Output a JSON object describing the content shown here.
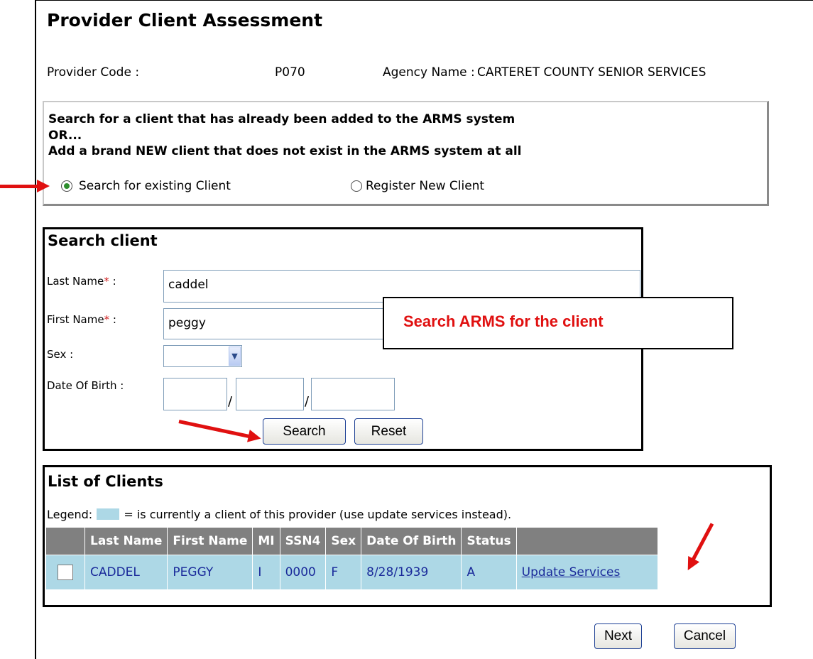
{
  "header": {
    "title": "Provider Client Assessment"
  },
  "provider": {
    "code_label": "Provider Code :",
    "code_value": "P070",
    "agency_label": "Agency Name :",
    "agency_value": "CARTERET COUNTY SENIOR SERVICES"
  },
  "search_mode": {
    "line1": "Search for a client that has already been added to the ARMS system",
    "line2": "OR...",
    "line3": "Add a brand NEW client that does not exist in the ARMS system at all",
    "option_existing": "Search for existing Client",
    "option_new": "Register New Client",
    "selected": "existing"
  },
  "search_client": {
    "title": "Search client",
    "last_name_label": "Last Name",
    "first_name_label": "First Name",
    "required_mark": "*",
    "colon": ":",
    "last_name_value": "caddel",
    "first_name_value": "peggy",
    "sex_label": "Sex :",
    "sex_value": "",
    "dob_label": "Date Of Birth :",
    "dob_sep": "/",
    "search_button": "Search",
    "reset_button": "Reset"
  },
  "callout": {
    "text": "Search ARMS for the client"
  },
  "clients": {
    "title": "List of Clients",
    "legend_prefix": "Legend:",
    "legend_text": "= is currently a client of this provider (use update services instead).",
    "legend_color": "#add8e6",
    "columns": [
      "Last Name",
      "First Name",
      "MI",
      "SSN4",
      "Sex",
      "Date Of Birth",
      "Status"
    ],
    "rows": [
      {
        "last": "CADDEL",
        "first": "PEGGY",
        "mi": "I",
        "ssn4": "0000",
        "sex": "F",
        "dob": "8/28/1939",
        "status": "A",
        "action": "Update Services"
      }
    ]
  },
  "footer": {
    "next_button": "Next",
    "cancel_button": "Cancel"
  },
  "colors": {
    "annotation_red": "#e01010",
    "header_gray": "#808080",
    "row_blue": "#add8e6"
  }
}
